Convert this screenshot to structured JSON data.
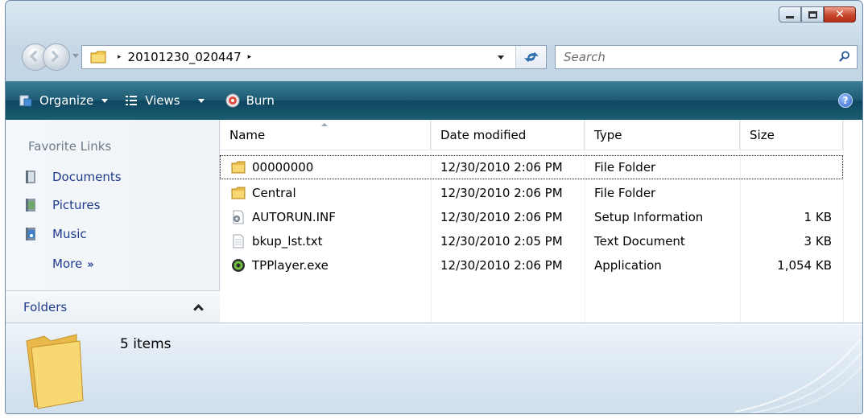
{
  "window": {
    "caption_buttons": [
      "minimize",
      "maximize",
      "close"
    ],
    "close_glyph": "✕"
  },
  "address_bar": {
    "path": "20101230_020447",
    "separator": "▸"
  },
  "search": {
    "placeholder": "Search"
  },
  "toolbar": {
    "organize_label": "Organize",
    "views_label": "Views",
    "burn_label": "Burn",
    "help_glyph": "?"
  },
  "sidebar": {
    "favorites_title": "Favorite Links",
    "items": [
      {
        "label": "Documents",
        "icon": "documents-icon"
      },
      {
        "label": "Pictures",
        "icon": "pictures-icon"
      },
      {
        "label": "Music",
        "icon": "music-icon"
      }
    ],
    "more_label": "More",
    "more_glyph": "»",
    "folders_label": "Folders"
  },
  "file_list": {
    "columns": [
      "Name",
      "Date modified",
      "Type",
      "Size"
    ],
    "rows": [
      {
        "name": "00000000",
        "date": "12/30/2010 2:06 PM",
        "type": "File Folder",
        "size": "",
        "icon": "folder-icon",
        "selected": true
      },
      {
        "name": "Central",
        "date": "12/30/2010 2:06 PM",
        "type": "File Folder",
        "size": "",
        "icon": "folder-icon",
        "selected": false
      },
      {
        "name": "AUTORUN.INF",
        "date": "12/30/2010 2:06 PM",
        "type": "Setup Information",
        "size": "1 KB",
        "icon": "setup-file-icon",
        "selected": false
      },
      {
        "name": "bkup_lst.txt",
        "date": "12/30/2010 2:05 PM",
        "type": "Text Document",
        "size": "3 KB",
        "icon": "text-file-icon",
        "selected": false
      },
      {
        "name": "TPPlayer.exe",
        "date": "12/30/2010 2:06 PM",
        "type": "Application",
        "size": "1,054 KB",
        "icon": "application-icon",
        "selected": false
      }
    ]
  },
  "details_pane": {
    "item_count": "5 items"
  },
  "colors": {
    "toolbar": "#1d5b73",
    "link": "#1e3b8c",
    "folder": "#f2c94c"
  }
}
